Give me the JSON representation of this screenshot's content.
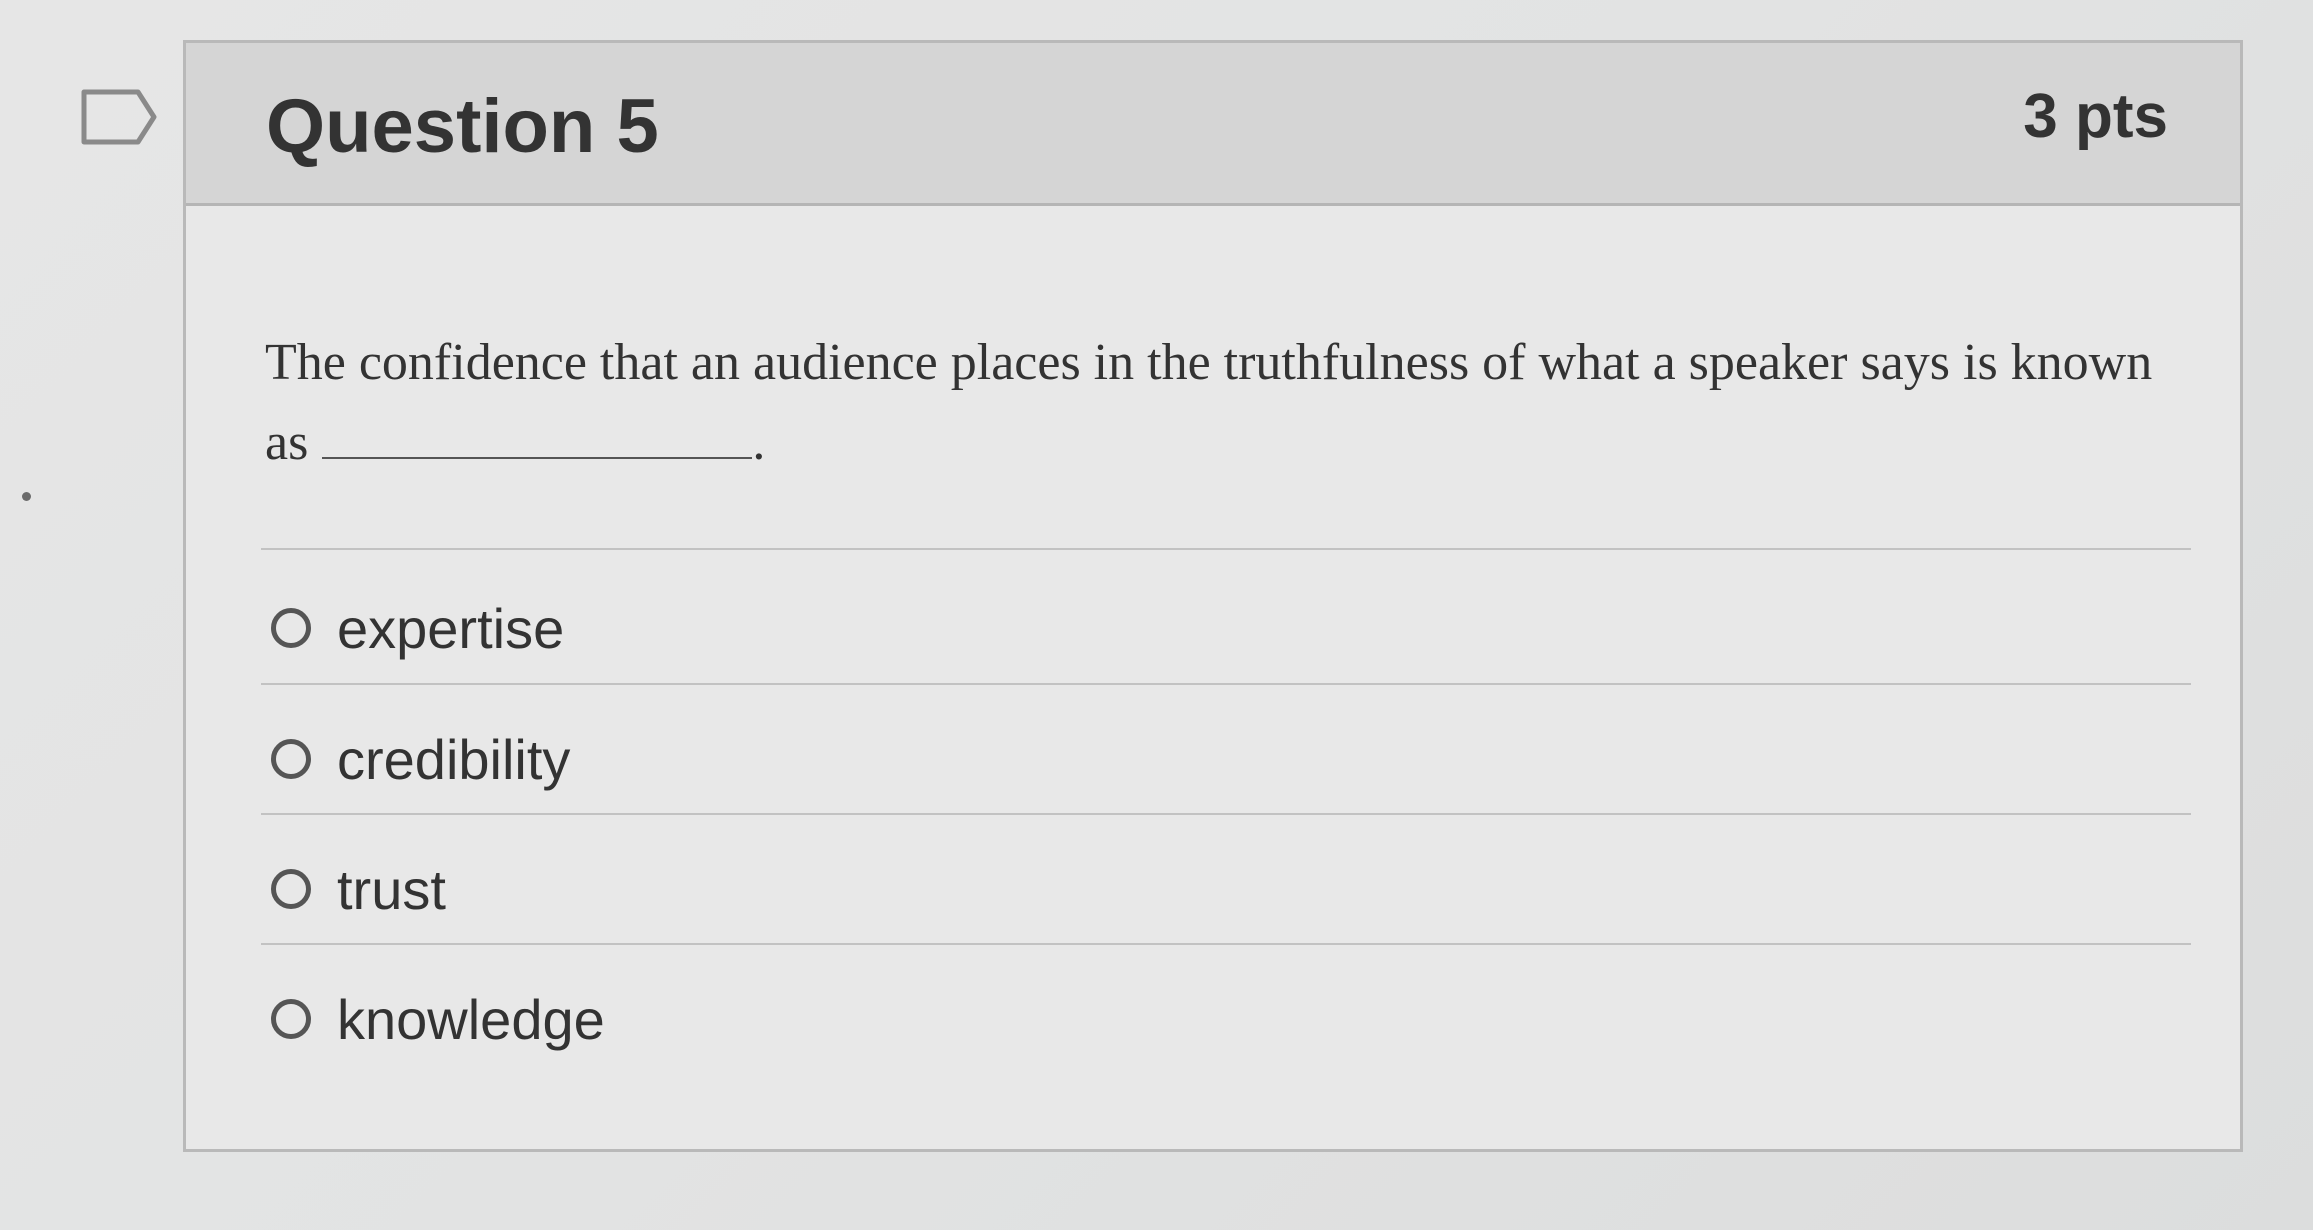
{
  "question": {
    "title": "Question 5",
    "points": "3 pts",
    "text": "The confidence that an audience places in the truthfulness of what a speaker says is known as",
    "text_end": "."
  },
  "answers": [
    {
      "label": "expertise",
      "selected": false
    },
    {
      "label": "credibility",
      "selected": false
    },
    {
      "label": "trust",
      "selected": false
    },
    {
      "label": "knowledge",
      "selected": false
    }
  ],
  "colors": {
    "text": "#333333",
    "header_bg": "#d5d5d5",
    "card_bg": "#e8e8e8",
    "border": "#b9b9b9"
  },
  "icons": {
    "question_marker": "flag-outline-icon",
    "answer_control": "radio-circle-icon"
  }
}
